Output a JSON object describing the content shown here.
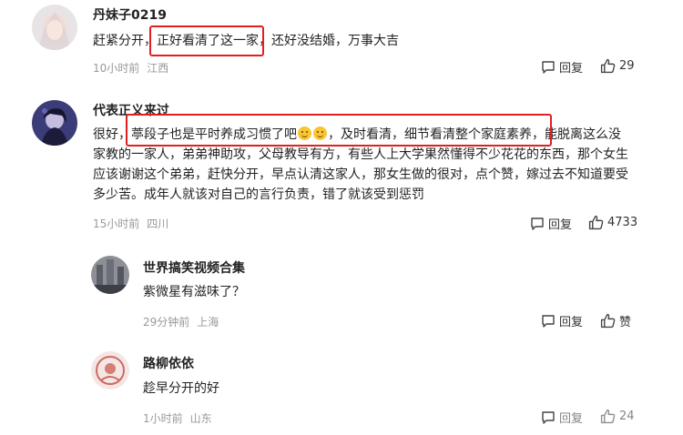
{
  "comments": [
    {
      "user": "丹妹子0219",
      "text_before": "赶紧分开，",
      "text_highlight": "正好看清了这一家",
      "text_after": "，还好没结婚，万事大吉",
      "time": "10小时前",
      "location": "江西",
      "reply_label": "回复",
      "likes": "29"
    },
    {
      "user": "代表正义来过",
      "line1_before": "很好，",
      "line1_highlight_a": "葶段子也是平时养成习惯了吧",
      "line1_highlight_b": "，及时看清，细节看清整个家庭素养",
      "line1_after": "，能脱离这么没",
      "lines": [
        "家教的一家人，弟弟神助攻，父母教导有方，有些人上大学果然懂得不少花花的东西，那个女生",
        "应该谢谢这个弟弟，赶快分开，早点认清这家人，那女生做的很对，点个赞，嫁过去不知道要受",
        "多少苦。成年人就该对自己的言行负责，错了就该受到惩罚"
      ],
      "time": "15小时前",
      "location": "四川",
      "reply_label": "回复",
      "likes": "4733"
    },
    {
      "user": "世界搞笑视频合集",
      "text": "紫微星有滋味了？",
      "time": "29分钟前",
      "location": "上海",
      "reply_label": "回复",
      "likes": "赞"
    },
    {
      "user": "路柳依依",
      "text": "趁早分开的好",
      "time": "1小时前",
      "location": "山东",
      "reply_label": "回复",
      "likes": "24"
    }
  ],
  "colors": {
    "highlight_box": "#e02020",
    "meta_text": "#999999"
  },
  "icons": [
    "comment-reply-icon",
    "thumbs-up-icon",
    "smile-emoji-icon"
  ]
}
